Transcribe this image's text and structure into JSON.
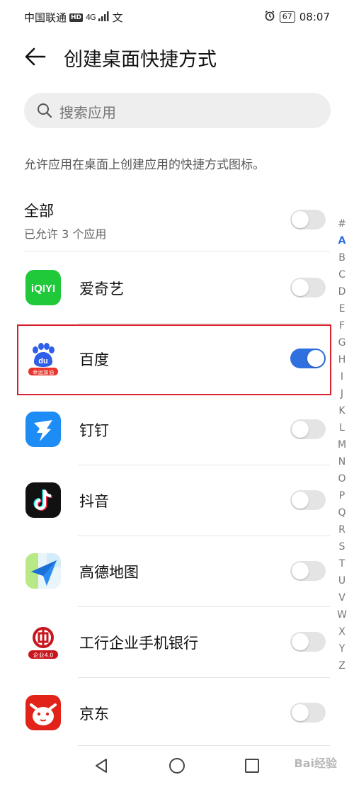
{
  "status_bar": {
    "carrier": "中国联通",
    "hd": "HD",
    "network": "4G",
    "extra_icon": "文",
    "battery": "67",
    "time": "08:07"
  },
  "header": {
    "title": "创建桌面快捷方式"
  },
  "search": {
    "placeholder": "搜索应用"
  },
  "description": "允许应用在桌面上创建应用的快捷方式图标。",
  "all": {
    "title": "全部",
    "subtitle": "已允许 3 个应用",
    "enabled": false
  },
  "apps": [
    {
      "name": "爱奇艺",
      "icon": "iqiyi-icon",
      "icon_text": "iQIYI",
      "color": "#1fc93a",
      "enabled": false
    },
    {
      "name": "百度",
      "icon": "baidu-icon",
      "icon_text": "du",
      "icon_caption": "幸运加油",
      "color": "#2f5ee8",
      "enabled": true
    },
    {
      "name": "钉钉",
      "icon": "dingtalk-icon",
      "color": "#1e8cf5",
      "enabled": false
    },
    {
      "name": "抖音",
      "icon": "douyin-icon",
      "color": "#111111",
      "enabled": false
    },
    {
      "name": "高德地图",
      "icon": "amap-icon",
      "color": "#2a8cf0",
      "enabled": false
    },
    {
      "name": "工行企业手机银行",
      "icon": "icbc-icon",
      "icon_caption": "企业4.0",
      "color": "#c8161d",
      "enabled": false
    },
    {
      "name": "京东",
      "icon": "jd-icon",
      "color": "#e2231a",
      "enabled": false
    }
  ],
  "index_letters": [
    "#",
    "A",
    "B",
    "C",
    "D",
    "E",
    "F",
    "G",
    "H",
    "I",
    "J",
    "K",
    "L",
    "M",
    "N",
    "O",
    "P",
    "Q",
    "R",
    "S",
    "T",
    "U",
    "V",
    "W",
    "X",
    "Y",
    "Z"
  ],
  "index_active": "A",
  "watermark": "Bai经验",
  "colors": {
    "accent": "#2f6fde",
    "highlight": "#d6202b"
  }
}
